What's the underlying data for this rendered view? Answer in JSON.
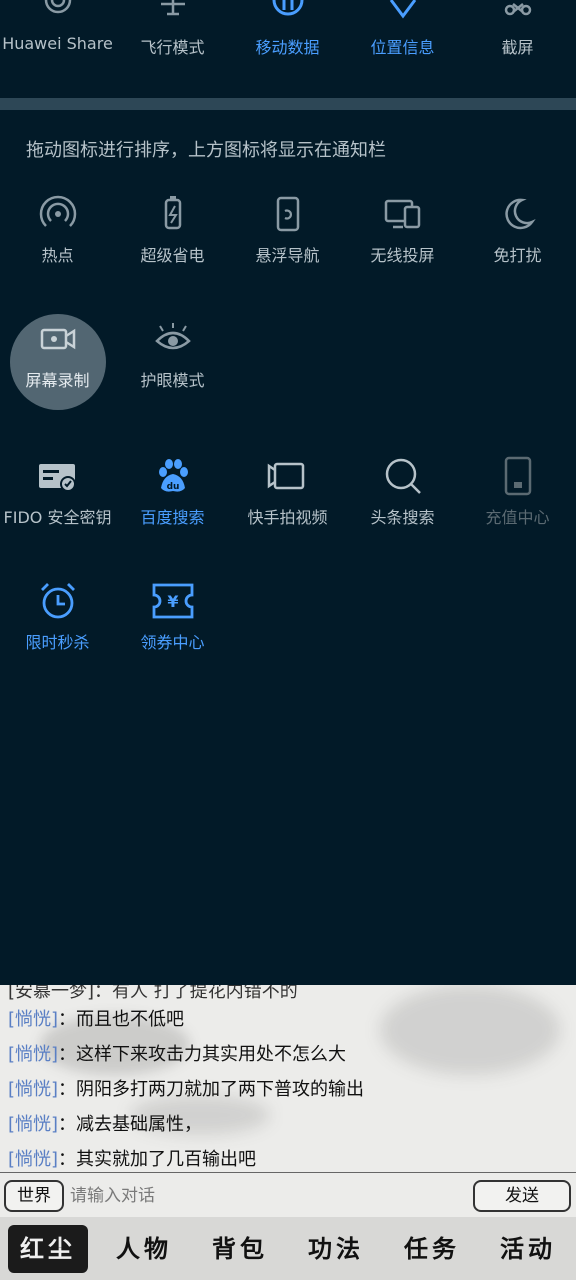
{
  "top_row": [
    {
      "label": "Huawei Share",
      "icon": "huawei-share-icon",
      "active": false
    },
    {
      "label": "飞行模式",
      "icon": "airplane-icon",
      "active": false
    },
    {
      "label": "移动数据",
      "icon": "mobile-data-icon",
      "active": true
    },
    {
      "label": "位置信息",
      "icon": "location-icon",
      "active": true
    },
    {
      "label": "截屏",
      "icon": "screenshot-icon",
      "active": false
    }
  ],
  "hint": "拖动图标进行排序，上方图标将显示在通知栏",
  "tiles_row1": [
    {
      "label": "热点",
      "icon": "hotspot-icon"
    },
    {
      "label": "超级省电",
      "icon": "battery-saver-icon"
    },
    {
      "label": "悬浮导航",
      "icon": "floating-nav-icon"
    },
    {
      "label": "无线投屏",
      "icon": "wireless-projection-icon"
    },
    {
      "label": "免打扰",
      "icon": "moon-icon"
    }
  ],
  "tiles_row2": [
    {
      "label": "屏幕录制",
      "icon": "screen-record-icon"
    },
    {
      "label": "护眼模式",
      "icon": "eye-comfort-icon"
    }
  ],
  "tiles_row3": [
    {
      "label": "FIDO 安全密钥",
      "icon": "fido-key-icon"
    },
    {
      "label": "百度搜索",
      "icon": "baidu-paw-icon"
    },
    {
      "label": "快手拍视频",
      "icon": "kuaishou-video-icon"
    },
    {
      "label": "头条搜索",
      "icon": "search-icon"
    },
    {
      "label": "充值中心",
      "icon": "recharge-icon"
    }
  ],
  "tiles_row4": [
    {
      "label": "限时秒杀",
      "icon": "alarm-clock-icon"
    },
    {
      "label": "领券中心",
      "icon": "coupon-icon"
    }
  ],
  "colors": {
    "background": "#021a28",
    "active": "#4a9eff",
    "text": "#b6c2c9",
    "chat_name": "#5a7fc4"
  },
  "chat": {
    "cut_line": "[安慕一梦]：有人 打了提花内错不的",
    "lines": [
      {
        "who": "[惝恍]",
        "text": "：而且也不低吧"
      },
      {
        "who": "[惝恍]",
        "text": "：这样下来攻击力其实用处不怎么大"
      },
      {
        "who": "[惝恍]",
        "text": "：阴阳多打两刀就加了两下普攻的输出"
      },
      {
        "who": "[惝恍]",
        "text": "：减去基础属性，"
      },
      {
        "who": "[惝恍]",
        "text": "：其实就加了几百输出吧"
      }
    ],
    "channel_button": "世界",
    "input_placeholder": "请输入对话",
    "send_button": "发送"
  },
  "bottom_nav": [
    "红尘",
    "人物",
    "背包",
    "功法",
    "任务",
    "活动"
  ]
}
